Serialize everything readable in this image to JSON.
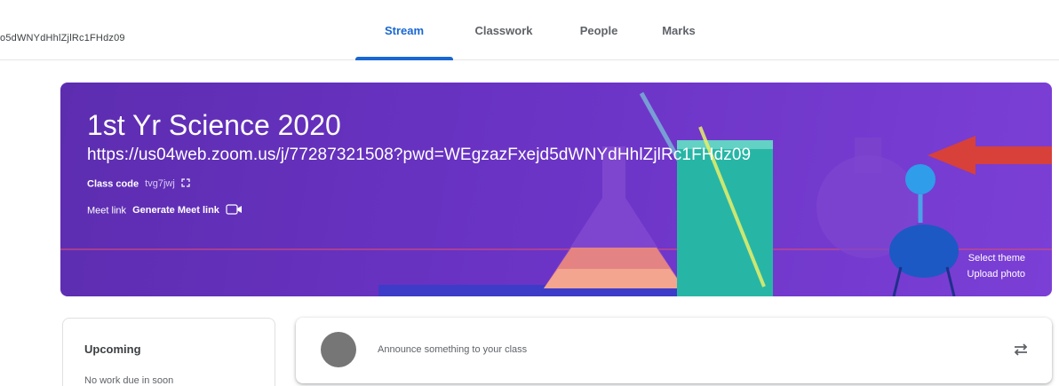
{
  "header": {
    "breadcrumb": "o5dWNYdHhlZjlRc1FHdz09",
    "tabs": [
      {
        "label": "Stream",
        "active": true
      },
      {
        "label": "Classwork",
        "active": false
      },
      {
        "label": "People",
        "active": false
      },
      {
        "label": "Marks",
        "active": false
      }
    ],
    "accent_color": "#1967d2"
  },
  "banner": {
    "title": "1st Yr Science 2020",
    "subtitle": "https://us04web.zoom.us/j/77287321508?pwd=WEgzazFxejd5dWNYdHhlZjlRc1FHdz09",
    "class_code_label": "Class code",
    "class_code": "tvg7jwj",
    "meet_label": "Meet link",
    "meet_action": "Generate Meet link",
    "select_theme": "Select theme",
    "upload_photo": "Upload photo",
    "background_color": "#6a33c4"
  },
  "upcoming": {
    "title": "Upcoming",
    "empty_text": "No work due in soon"
  },
  "announce": {
    "placeholder": "Announce something to your class"
  },
  "icons": {
    "class_code_icon": "fullscreen-icon",
    "meet_icon": "video-camera-icon",
    "repost_icon": "repost-icon",
    "arrow": "red-arrow-annotation"
  }
}
